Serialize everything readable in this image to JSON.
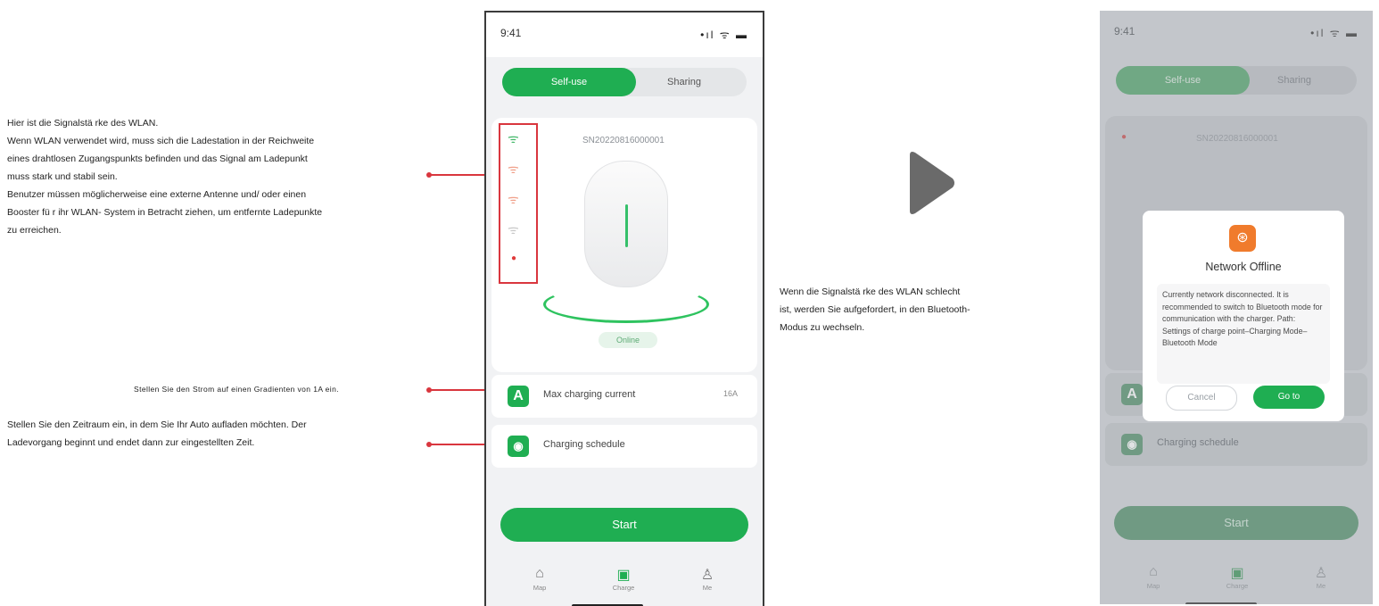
{
  "annotations": {
    "signal": [
      "Hier ist die Signalstä rke des WLAN.",
      "Wenn WLAN verwendet wird, muss sich die Ladestation in der Reichweite",
      "eines drahtlosen Zugangspunkts befinden und das Signal am Ladepunkt",
      "muss stark und stabil sein.",
      "Benutzer müssen möglicherweise eine externe Antenne und/ oder einen",
      "Booster fü r ihr WLAN- System in Betracht ziehen, um entfernte Ladepunkte",
      "zu erreichen."
    ],
    "current": "Stellen Sie den Strom auf einen Gradienten von 1A ein.",
    "schedule": [
      "Stellen Sie den Zeitraum ein, in dem Sie Ihr Auto aufladen möchten. Der",
      "Ladevorgang beginnt und endet dann zur eingestellten Zeit."
    ],
    "offline_note": [
      "Wenn die Signalstä rke des WLAN schlecht",
      "ist, werden Sie aufgefordert, in den Bluetooth-",
      "Modus zu wechseln."
    ]
  },
  "phone": {
    "time": "9:41",
    "status_icons": "•ıl ᯤ ▬",
    "tabs": [
      "Self-use",
      "Sharing"
    ],
    "serial": "SN20220816000001",
    "status": "Online",
    "rows": [
      {
        "icon": "A",
        "label": "Max charging current",
        "value": "16A"
      },
      {
        "icon": "◉",
        "label": "Charging schedule",
        "value": ""
      }
    ],
    "start": "Start",
    "nav": [
      {
        "label": "Map",
        "icon": "map-icon"
      },
      {
        "label": "Charge",
        "icon": "charger-icon"
      },
      {
        "label": "Me",
        "icon": "user-icon"
      }
    ]
  },
  "modal": {
    "title": "Network Offline",
    "body": "Currently network disconnected. It is recommended to switch to Bluetooth mode for communication with the charger. Path: Settings of charge point–Charging Mode–Bluetooth Mode",
    "cancel": "Cancel",
    "go": "Go to"
  },
  "colors": {
    "accent": "#1fae52",
    "annotation": "#d9363e",
    "warning": "#f07b2c"
  }
}
